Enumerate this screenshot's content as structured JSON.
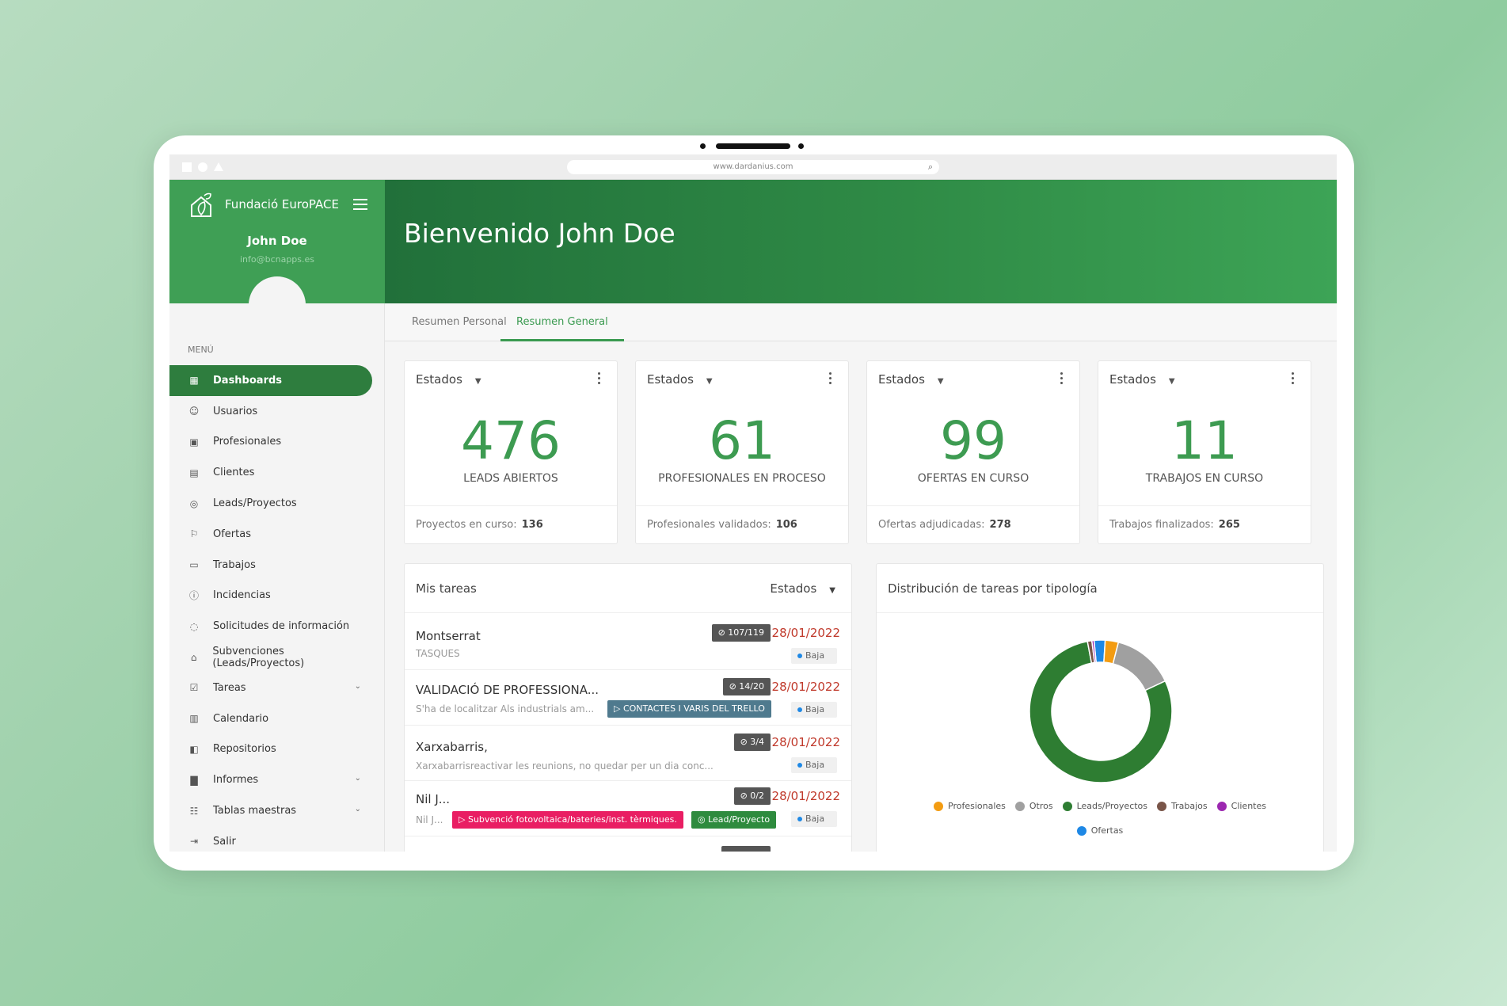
{
  "browser": {
    "url": "www.dardanius.com"
  },
  "sidebar": {
    "org_name": "Fundació EuroPACE",
    "user_name": "John Doe",
    "user_email": "info@bcnapps.es",
    "menu_title": "MENÚ",
    "items": [
      {
        "label": "Dashboards",
        "icon": "dashboard-icon",
        "active": true
      },
      {
        "label": "Usuarios",
        "icon": "users-icon"
      },
      {
        "label": "Profesionales",
        "icon": "briefcase-icon"
      },
      {
        "label": "Clientes",
        "icon": "building-icon"
      },
      {
        "label": "Leads/Proyectos",
        "icon": "globe-icon"
      },
      {
        "label": "Ofertas",
        "icon": "flag-icon"
      },
      {
        "label": "Trabajos",
        "icon": "bag-icon"
      },
      {
        "label": "Incidencias",
        "icon": "alert-icon"
      },
      {
        "label": "Solicitudes de información",
        "icon": "bell-icon"
      },
      {
        "label": "Subvenciones (Leads/Proyectos)",
        "icon": "bank-icon"
      },
      {
        "label": "Tareas",
        "icon": "check-icon",
        "expandable": true
      },
      {
        "label": "Calendario",
        "icon": "calendar-icon"
      },
      {
        "label": "Repositorios",
        "icon": "folder-icon"
      },
      {
        "label": "Informes",
        "icon": "bar-chart-icon",
        "expandable": true
      },
      {
        "label": "Tablas maestras",
        "icon": "grid-icon",
        "expandable": true
      },
      {
        "label": "Salir",
        "icon": "logout-icon"
      }
    ]
  },
  "header": {
    "title": "Bienvenido John Doe"
  },
  "tabs": [
    {
      "label": "Resumen Personal",
      "active": false
    },
    {
      "label": "Resumen General",
      "active": true
    }
  ],
  "stats": [
    {
      "filter": "Estados",
      "value": "476",
      "label": "LEADS ABIERTOS",
      "foot_label": "Proyectos en curso:",
      "foot_value": "136"
    },
    {
      "filter": "Estados",
      "value": "61",
      "label": "PROFESIONALES EN PROCESO",
      "foot_label": "Profesionales validados:",
      "foot_value": "106"
    },
    {
      "filter": "Estados",
      "value": "99",
      "label": "OFERTAS EN CURSO",
      "foot_label": "Ofertas adjudicadas:",
      "foot_value": "278"
    },
    {
      "filter": "Estados",
      "value": "11",
      "label": "TRABAJOS EN CURSO",
      "foot_label": "Trabajos finalizados:",
      "foot_value": "265"
    }
  ],
  "tasks": {
    "title": "Mis tareas",
    "filter": "Estados",
    "items": [
      {
        "title": "Montserrat",
        "subtitle": "TASQUES",
        "checklist": "107/119",
        "date": "28/01/2022",
        "priority": "Baja"
      },
      {
        "title": "VALIDACIÓ DE PROFESSIONA...",
        "subtitle": "S'ha de localitzar Als industrials am...",
        "checklist": "14/20",
        "date": "28/01/2022",
        "priority": "Baja",
        "tag": "CONTACTES I VARIS DEL TRELLO"
      },
      {
        "title": "Xarxabarris,",
        "subtitle": "Xarxabarrisreactivar les reunions, no quedar per un dia conc...",
        "checklist": "3/4",
        "date": "28/01/2022",
        "priority": "Baja"
      },
      {
        "title": "Nil J...",
        "subtitle": "Nil J...",
        "checklist": "0/2",
        "date": "28/01/2022",
        "priority": "Baja",
        "tag": "Subvenció fotovoltaica/bateries/inst. tèrmiques.",
        "tag2": "Lead/Proyecto"
      }
    ]
  },
  "chart_data": {
    "type": "pie",
    "title": "Distribución de tareas por tipología",
    "donut": true,
    "legend_position": "bottom",
    "slices": [
      {
        "name": "Profesionales",
        "value": 3,
        "color": "#f39c12"
      },
      {
        "name": "Otros",
        "value": 14,
        "color": "#a0a0a0"
      },
      {
        "name": "Leads/Proyectos",
        "value": 79,
        "color": "#2e7d32"
      },
      {
        "name": "Trabajos",
        "value": 1,
        "color": "#795548"
      },
      {
        "name": "Clientes",
        "value": 0.5,
        "color": "#9c27b0"
      },
      {
        "name": "Ofertas",
        "value": 2.5,
        "color": "#1e88e5"
      }
    ]
  }
}
